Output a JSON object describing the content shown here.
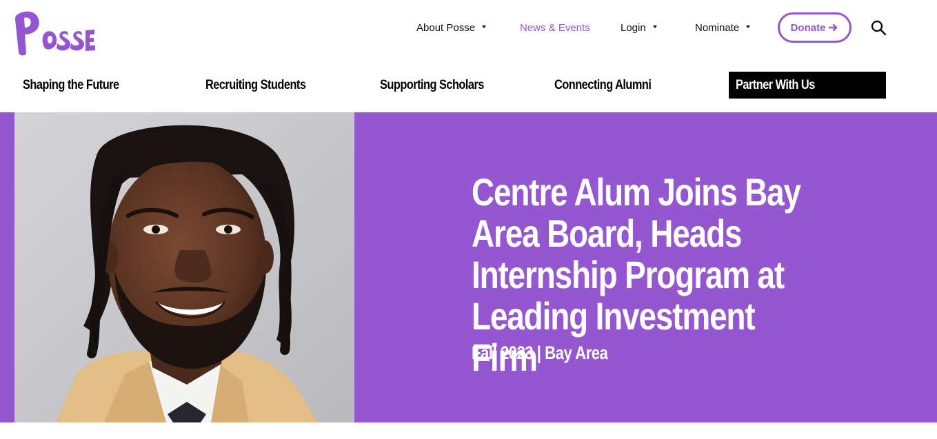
{
  "brand": {
    "logo_text": "Posse",
    "accent_color": "#9555d0"
  },
  "top_nav": {
    "items": [
      {
        "label": "About Posse",
        "has_dropdown": true
      },
      {
        "label": "News & Events",
        "has_dropdown": false,
        "active": true
      },
      {
        "label": "Login",
        "has_dropdown": true
      },
      {
        "label": "Nominate",
        "has_dropdown": true
      }
    ],
    "donate_label": "Donate",
    "donate_icon": "arrow-right-icon",
    "search_icon": "search-icon"
  },
  "main_nav": {
    "items": [
      {
        "label": "Shaping the Future"
      },
      {
        "label": "Recruiting Students"
      },
      {
        "label": "Supporting Scholars"
      },
      {
        "label": "Connecting Alumni"
      }
    ],
    "cta_label": "Partner With Us"
  },
  "hero": {
    "title": "Centre Alum Joins Bay Area Board, Heads Internship Program at Leading Investment Firm",
    "meta": "Fall 2023 | Bay Area",
    "background_color": "#9557d0",
    "photo_icon": "portrait-photo"
  }
}
